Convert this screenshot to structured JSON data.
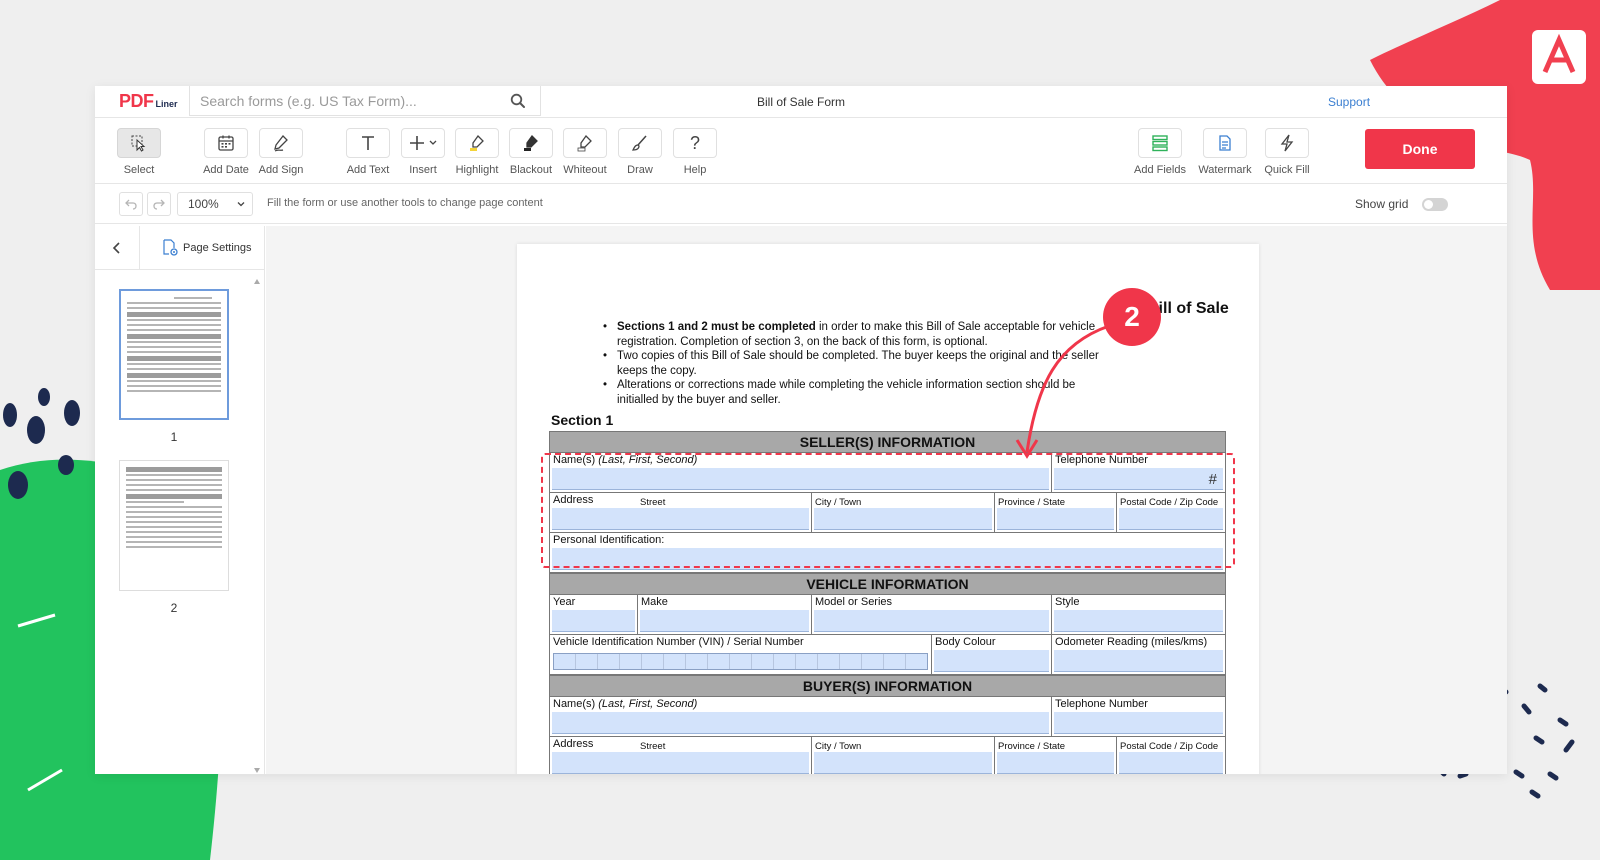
{
  "app": {
    "logo": "PDF",
    "logo_sub": "Liner",
    "search_placeholder": "Search forms (e.g. US Tax Form)...",
    "doc_title": "Bill of Sale Form",
    "support": "Support"
  },
  "toolbar": {
    "tools": [
      {
        "label": "Select",
        "icon": "select-cursor-icon"
      },
      {
        "label": "Add Date",
        "icon": "calendar-icon"
      },
      {
        "label": "Add Sign",
        "icon": "signature-pen-icon"
      },
      {
        "label": "Add Text",
        "icon": "text-t-icon"
      },
      {
        "label": "Insert",
        "icon": "plus-icon"
      },
      {
        "label": "Highlight",
        "icon": "highlighter-icon"
      },
      {
        "label": "Blackout",
        "icon": "blackout-marker-icon"
      },
      {
        "label": "Whiteout",
        "icon": "whiteout-marker-icon"
      },
      {
        "label": "Draw",
        "icon": "brush-icon"
      },
      {
        "label": "Help",
        "icon": "question-icon"
      },
      {
        "label": "Add Fields",
        "icon": "fields-icon"
      },
      {
        "label": "Watermark",
        "icon": "watermark-icon"
      },
      {
        "label": "Quick Fill",
        "icon": "lightning-icon"
      }
    ],
    "done": "Done"
  },
  "subbar": {
    "zoom": "100%",
    "hint": "Fill the form or use another tools to change page content",
    "show_grid": "Show grid"
  },
  "sidebar": {
    "page_settings": "Page Settings",
    "pages": [
      "1",
      "2"
    ]
  },
  "document": {
    "title": "Bill of Sale",
    "bullets": {
      "b1_bold": "Sections 1 and 2 must be completed",
      "b1_rest": " in order to make this Bill of Sale acceptable for vehicle registration. Completion of section 3, on the back of this form, is optional.",
      "b2": "Two copies of this Bill of Sale should be completed. The buyer keeps the original and the seller keeps the copy.",
      "b3": "Alterations or corrections made while completing the vehicle information section should be initialled by the buyer and seller."
    },
    "section_label": "Section 1",
    "seller_band": "SELLER(S) INFORMATION",
    "vehicle_band": "VEHICLE INFORMATION",
    "buyer_band": "BUYER(S) INFORMATION",
    "fields": {
      "names": "Name(s)",
      "names_hint": "(Last, First, Second)",
      "telephone": "Telephone Number",
      "address": "Address",
      "street": "Street",
      "city": "City / Town",
      "province": "Province / State",
      "postal": "Postal Code / Zip Code",
      "personal_id": "Personal Identification:",
      "year": "Year",
      "make": "Make",
      "model": "Model or Series",
      "style": "Style",
      "vin": "Vehicle Identification Number (VIN) / Serial Number",
      "body_colour": "Body Colour",
      "odometer": "Odometer Reading (miles/kms)",
      "hash": "#"
    }
  },
  "annotation": {
    "step": "2"
  },
  "colors": {
    "accent": "#f0364a",
    "field_fill": "#d3e3fb",
    "band_gray": "#a8a8a8",
    "link": "#3b7fd1",
    "bg_green": "#22c35e"
  }
}
